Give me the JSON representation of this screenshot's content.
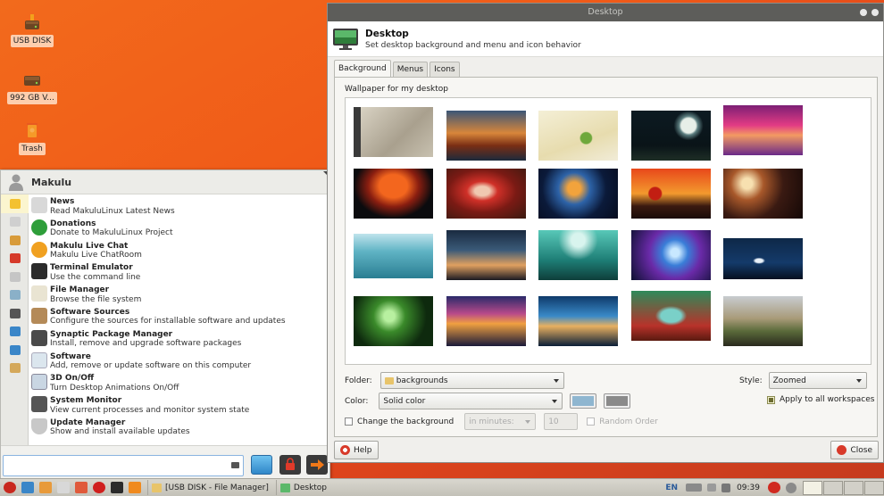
{
  "desktop": {
    "icons": [
      {
        "label": "USB DISK",
        "icon": "usb-drive-icon"
      },
      {
        "label": "992 GB V...",
        "icon": "hard-drive-icon"
      },
      {
        "label": "Trash",
        "icon": "trash-icon"
      }
    ]
  },
  "menu": {
    "username": "Makulu",
    "items": [
      {
        "title": "News",
        "subtitle": "Read MakuluLinux Latest News",
        "color": "#d8d8d8"
      },
      {
        "title": "Donations",
        "subtitle": "Donate to MakuluLinux Project",
        "color": "#2e9e3a"
      },
      {
        "title": "Makulu Live Chat",
        "subtitle": "Makulu Live ChatRoom",
        "color": "#f0a020"
      },
      {
        "title": "Terminal Emulator",
        "subtitle": "Use the command line",
        "color": "#2b2b2b"
      },
      {
        "title": "File Manager",
        "subtitle": "Browse the file system",
        "color": "#e9e4d2"
      },
      {
        "title": "Software Sources",
        "subtitle": "Configure the sources for installable software and updates",
        "color": "#b48a58"
      },
      {
        "title": "Synaptic Package Manager",
        "subtitle": "Install, remove and upgrade software packages",
        "color": "#4a4a4a"
      },
      {
        "title": "Software",
        "subtitle": "Add, remove or update software on this computer",
        "color": "#dbe6ee"
      },
      {
        "title": "3D On/Off",
        "subtitle": "Turn Desktop Animations On/Off",
        "color": "#c9d6e3"
      },
      {
        "title": "System Monitor",
        "subtitle": "View current processes and monitor system state",
        "color": "#555555"
      },
      {
        "title": "Update Manager",
        "subtitle": "Show and install available updates",
        "color": "#c8c8c8"
      }
    ],
    "search": {
      "value": ""
    }
  },
  "window": {
    "title": "Desktop",
    "header_title": "Desktop",
    "header_subtitle": "Set desktop background and menu and icon behavior",
    "tabs": [
      "Background",
      "Menus",
      "Icons"
    ],
    "active_tab": "Background",
    "wallpaper_label": "Wallpaper for my desktop",
    "folder_label": "Folder:",
    "folder_value": "backgrounds",
    "style_label": "Style:",
    "style_value": "Zoomed",
    "color_label": "Color:",
    "color_value": "Solid color",
    "primary_color": "#8fb6d0",
    "secondary_color": "#8a8a8a",
    "apply_all_label": "Apply to all workspaces",
    "apply_all_checked": true,
    "change_bg_label": "Change the background",
    "change_bg_checked": false,
    "interval_value": "in minutes:",
    "interval_number": "10",
    "random_order_label": "Random Order",
    "help_label": "Help",
    "close_label": "Close"
  },
  "taskbar": {
    "tasks": [
      {
        "label": "[USB DISK - File Manager]",
        "icon": "folder-icon"
      },
      {
        "label": "Desktop",
        "icon": "desktop-settings-icon"
      }
    ],
    "language": "EN",
    "clock": "09:39"
  }
}
